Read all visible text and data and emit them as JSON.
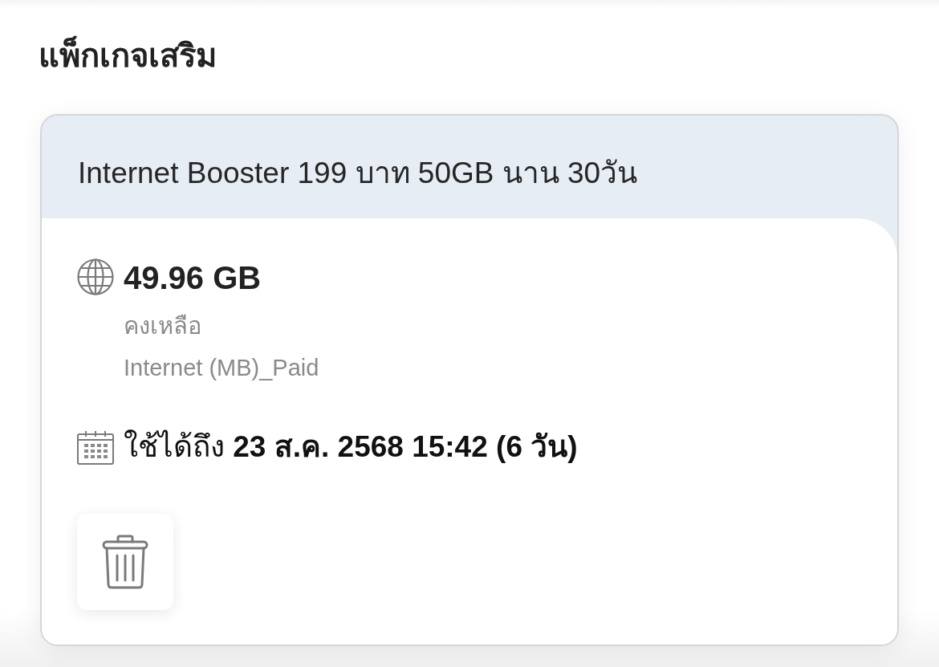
{
  "section": {
    "title": "แพ็กเกจเสริม"
  },
  "packages": [
    {
      "name": "Internet Booster 199 บาท 50GB นาน 30วัน",
      "remaining": "49.96 GB",
      "remaining_label": "คงเหลือ",
      "quota_type": "Internet (MB)_Paid",
      "validity": "ใช้ได้ถึง **23 ส.ค. 2568 15:42 (6 วัน)**"
    }
  ]
}
